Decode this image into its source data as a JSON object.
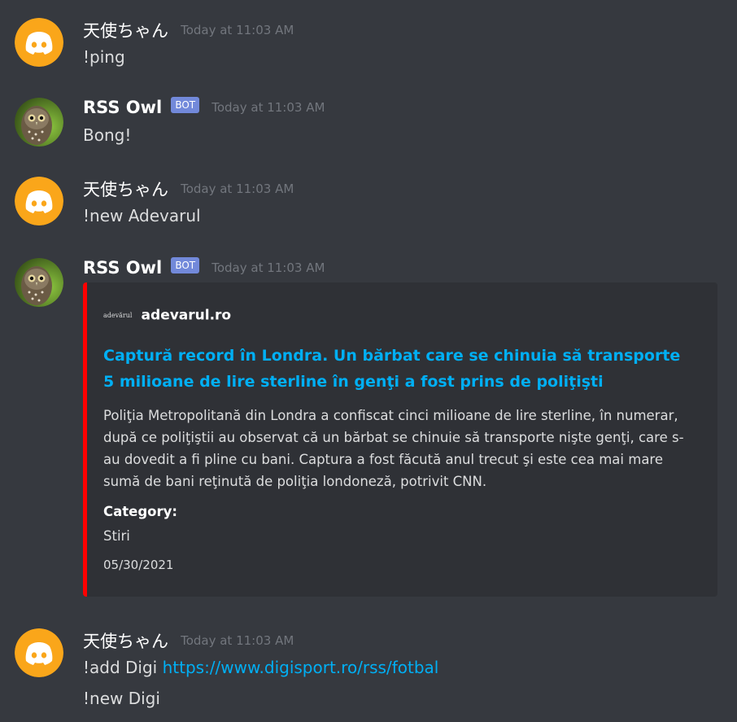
{
  "users": {
    "tenshi": "天使ちゃん",
    "owl": "RSS Owl",
    "bot_tag": "BOT"
  },
  "messages": [
    {
      "timestamp": "Today at 11:03 AM",
      "text": "!ping"
    },
    {
      "timestamp": "Today at 11:03 AM",
      "text": "Bong!"
    },
    {
      "timestamp": "Today at 11:03 AM",
      "text": "!new Adevarul"
    },
    {
      "timestamp": "Today at 11:03 AM"
    },
    {
      "timestamp": "Today at 11:03 AM",
      "text_prefix": "!add Digi ",
      "link": "https://www.digisport.ro/rss/fotbal",
      "text2": "!new Digi"
    }
  ],
  "embed": {
    "author_icon_text": "adevărul",
    "author_name": "adevarul.ro",
    "title": "Captură record în Londra. Un bărbat care se chinuia să transporte 5 milioane de lire sterline în genţi a fost prins de poliţişti",
    "description": "Poliţia Metropolitană din Londra a confiscat cinci milioane de lire sterline, în numerar, după ce poliţiştii au observat că un bărbat se chinuie să transporte nişte genţi, care s-au dovedit a fi pline cu bani. Captura a fost făcută anul trecut şi este cea mai mare sumă de bani reţinută de poliţia londoneză, potrivit CNN.",
    "field_name": "Category:",
    "field_value": "Stiri",
    "footer": "05/30/2021",
    "color": "#ff0000"
  },
  "colors": {
    "background": "#36393f",
    "embed_bg": "#2f3136",
    "link": "#00aff4",
    "bot_tag": "#7289da",
    "discord_avatar": "#faa61a"
  },
  "icons": {
    "discord_avatar": "discord-logo-icon",
    "owl_avatar": "owl-photo-icon"
  }
}
